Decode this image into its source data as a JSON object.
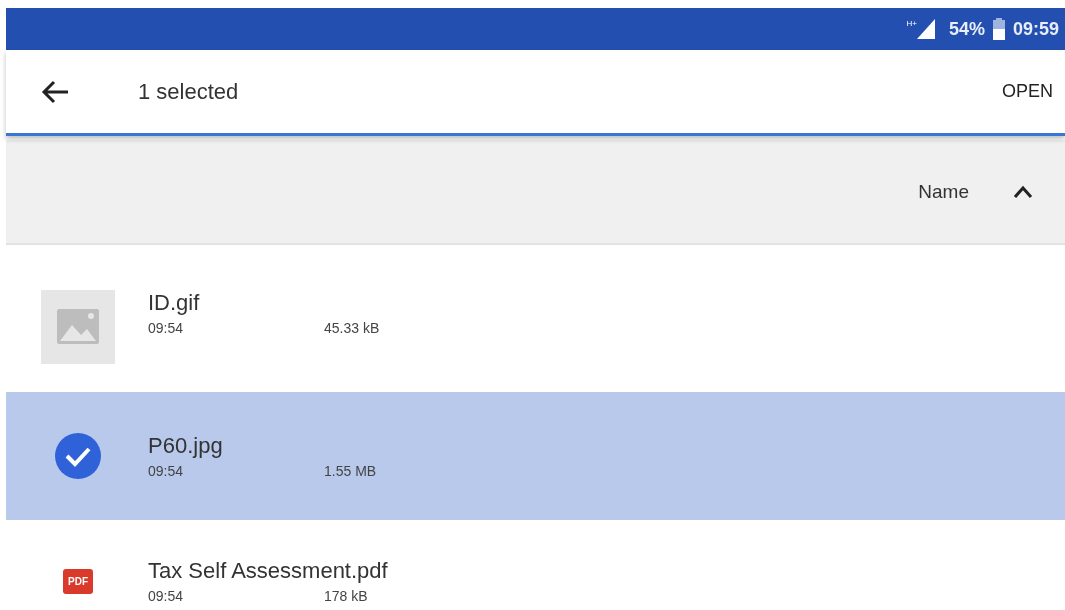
{
  "status_bar": {
    "network": "H+",
    "battery": "54%",
    "time": "09:59"
  },
  "toolbar": {
    "title": "1 selected",
    "action": "OPEN"
  },
  "sort": {
    "label": "Name",
    "ascending": true
  },
  "files": [
    {
      "name": "ID.gif",
      "time": "09:54",
      "size": "45.33 kB",
      "kind": "image",
      "selected": false
    },
    {
      "name": "P60.jpg",
      "time": "09:54",
      "size": "1.55 MB",
      "selected": true
    },
    {
      "name": "Tax Self Assessment.pdf",
      "time": "09:54",
      "size": "178 kB",
      "kind": "pdf",
      "icon_label": "PDF",
      "selected": false
    }
  ]
}
